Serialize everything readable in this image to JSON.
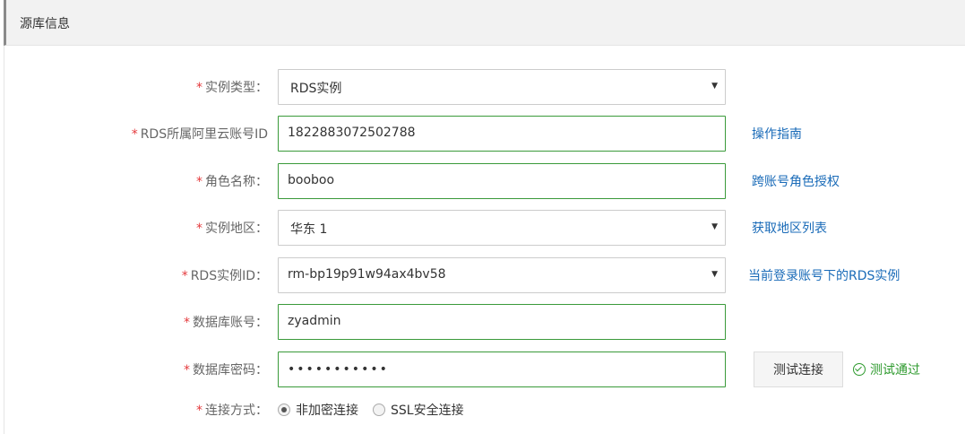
{
  "section": {
    "title": "源库信息"
  },
  "form": {
    "instance_type": {
      "label": "实例类型：",
      "value": "RDS实例"
    },
    "rds_account_id": {
      "label": "RDS所属阿里云账号ID",
      "value": "1822883072502788",
      "link": "操作指南"
    },
    "role_name": {
      "label": "角色名称：",
      "value": "booboo",
      "link": "跨账号角色授权"
    },
    "region": {
      "label": "实例地区：",
      "value": "华东 1",
      "link": "获取地区列表"
    },
    "rds_instance_id": {
      "label": "RDS实例ID：",
      "value": "rm-bp19p91w94ax4bv58",
      "link": "当前登录账号下的RDS实例"
    },
    "db_account": {
      "label": "数据库账号：",
      "value": "zyadmin"
    },
    "db_password": {
      "label": "数据库密码：",
      "value": "•••••••••••",
      "button": "测试连接",
      "status": "测试通过"
    },
    "connection": {
      "label": "连接方式：",
      "options": [
        {
          "label": "非加密连接",
          "checked": true
        },
        {
          "label": "SSL安全连接",
          "checked": false
        }
      ]
    },
    "required_mark": "*"
  },
  "colors": {
    "required": "#e4393c",
    "link": "#1a6bb8",
    "success": "#2e9a2e",
    "valid_border": "#3a9a3a"
  }
}
